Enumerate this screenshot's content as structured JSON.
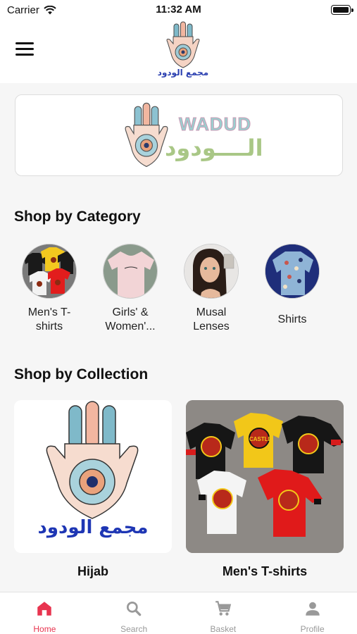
{
  "status_bar": {
    "carrier": "Carrier",
    "time": "11:32 AM"
  },
  "header": {
    "logo_caption": "مجمع الودود"
  },
  "banner": {
    "brand_latin": "WADUD",
    "brand_arabic": "الــــودود"
  },
  "categories_section": {
    "title": "Shop by Category",
    "items": [
      {
        "label": "Men's T-shirts"
      },
      {
        "label": "Girls' & Women'..."
      },
      {
        "label": "Musal Lenses"
      },
      {
        "label": "Shirts"
      }
    ]
  },
  "collections_section": {
    "title": "Shop by Collection",
    "items": [
      {
        "label": "Hijab",
        "image_caption": "مجمع الودود"
      },
      {
        "label": "Men's T-shirts",
        "shirt_print": "CASTLE"
      }
    ]
  },
  "tab_bar": {
    "tabs": [
      {
        "label": "Home",
        "icon": "home-icon"
      },
      {
        "label": "Search",
        "icon": "search-icon"
      },
      {
        "label": "Basket",
        "icon": "cart-icon"
      },
      {
        "label": "Profile",
        "icon": "person-icon"
      }
    ],
    "active_color": "#e8344f",
    "inactive_color": "#999999"
  }
}
